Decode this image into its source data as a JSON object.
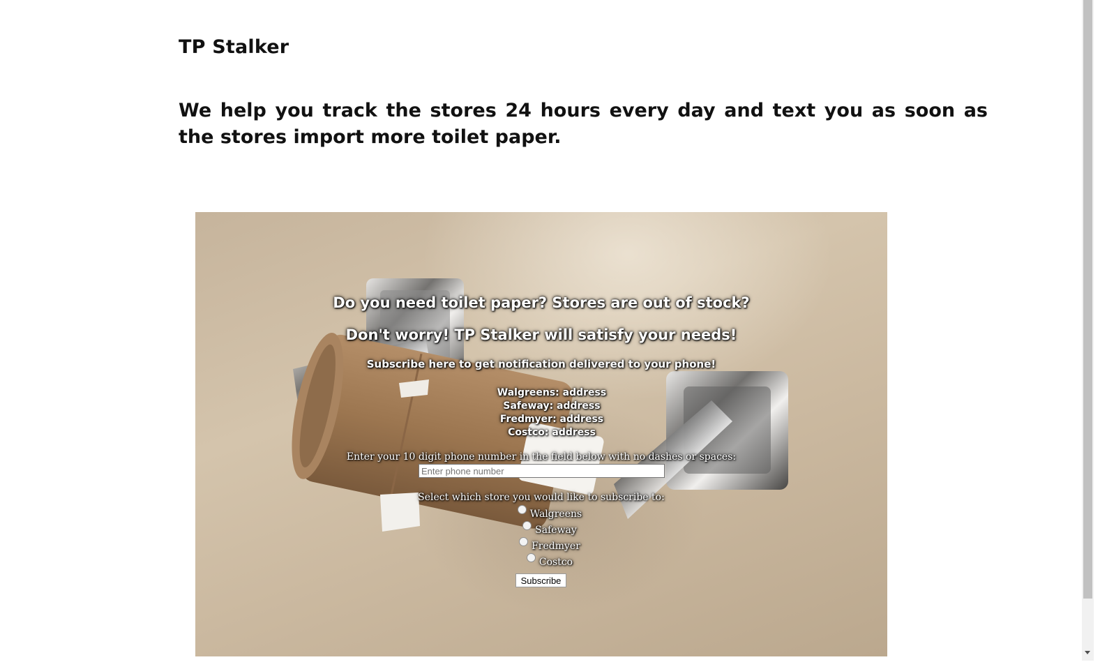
{
  "header": {
    "title": "TP Stalker",
    "tagline": "We help you track the stores 24 hours every day and text you as soon as the stores import more toilet paper."
  },
  "hero": {
    "question": "Do you need toilet paper? Stores are out of stock?",
    "answer": "Don't worry! TP Stalker will satisfy your needs!",
    "subscribe_prompt": "Subscribe here to get notification delivered to your phone!",
    "stores": [
      {
        "label": "Walgreens: address"
      },
      {
        "label": "Safeway: address"
      },
      {
        "label": "Fredmyer: address"
      },
      {
        "label": "Costco: address"
      }
    ]
  },
  "form": {
    "phone_label": "Enter your 10 digit phone number in the field below with no dashes or spaces:",
    "phone_placeholder": "Enter phone number",
    "phone_value": "",
    "select_label": "Select which store you would like to subscribe to:",
    "options": [
      {
        "label": "Walgreens"
      },
      {
        "label": "Safeway"
      },
      {
        "label": "Fredmyer"
      },
      {
        "label": "Costco"
      }
    ],
    "submit_label": "Subscribe"
  }
}
